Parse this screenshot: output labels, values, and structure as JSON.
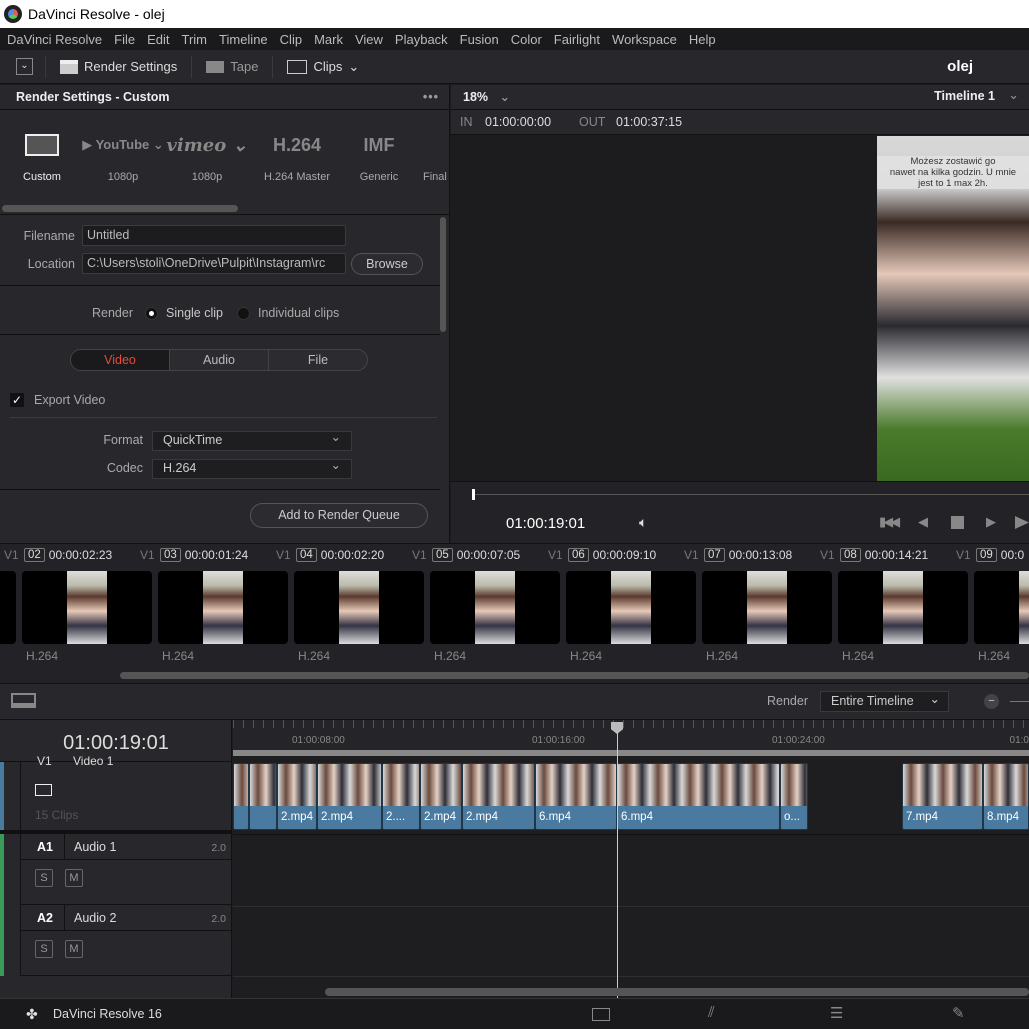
{
  "app": {
    "title": "DaVinci Resolve - olej",
    "project": "olej",
    "footer": "DaVinci Resolve 16"
  },
  "menu": [
    "DaVinci Resolve",
    "File",
    "Edit",
    "Trim",
    "Timeline",
    "Clip",
    "Mark",
    "View",
    "Playback",
    "Fusion",
    "Color",
    "Fairlight",
    "Workspace",
    "Help"
  ],
  "toolbar": {
    "render_settings": "Render Settings",
    "tape": "Tape",
    "clips": "Clips"
  },
  "render": {
    "title": "Render Settings - Custom",
    "more": "•••",
    "presets": [
      {
        "name": "",
        "label": "Custom",
        "icon": "film-icon"
      },
      {
        "name": "▶ YouTube ⌄",
        "label": "1080p"
      },
      {
        "name": "vimeo ⌄",
        "label": "1080p"
      },
      {
        "name": "H.264",
        "label": "H.264 Master"
      },
      {
        "name": "IMF",
        "label": "Generic"
      },
      {
        "name": "",
        "label": "Final"
      }
    ],
    "filename_label": "Filename",
    "filename": "Untitled",
    "location_label": "Location",
    "location": "C:\\Users\\stoli\\OneDrive\\Pulpit\\Instagram\\rc",
    "browse": "Browse",
    "render_label": "Render",
    "single_clip": "Single clip",
    "individual_clips": "Individual clips",
    "render_mode": "Single clip",
    "tabs": [
      "Video",
      "Audio",
      "File"
    ],
    "active_tab": "Video",
    "export_video": "Export Video",
    "export_video_checked": true,
    "format_label": "Format",
    "format": "QuickTime",
    "codec_label": "Codec",
    "codec": "H.264",
    "add_queue": "Add to Render Queue"
  },
  "viewer": {
    "zoom": "18%",
    "timeline": "Timeline 1",
    "in_label": "IN",
    "in": "01:00:00:00",
    "out_label": "OUT",
    "out": "01:00:37:15",
    "timecode": "01:00:19:01",
    "overlay_text": [
      "Możesz zostawić go",
      "nawet na kilka godzin. U mnie",
      "jest to 1 max 2h."
    ]
  },
  "clips": [
    {
      "track": "V1",
      "num": "02",
      "duration": "00:00:02:23",
      "codec": "H.264"
    },
    {
      "track": "V1",
      "num": "03",
      "duration": "00:00:01:24",
      "codec": "H.264"
    },
    {
      "track": "V1",
      "num": "04",
      "duration": "00:00:02:20",
      "codec": "H.264"
    },
    {
      "track": "V1",
      "num": "05",
      "duration": "00:00:07:05",
      "codec": "H.264"
    },
    {
      "track": "V1",
      "num": "06",
      "duration": "00:00:09:10",
      "codec": "H.264"
    },
    {
      "track": "V1",
      "num": "07",
      "duration": "00:00:13:08",
      "codec": "H.264"
    },
    {
      "track": "V1",
      "num": "08",
      "duration": "00:00:14:21",
      "codec": "H.264"
    },
    {
      "track": "V1",
      "num": "09",
      "duration": "00:0",
      "codec": "H.264"
    }
  ],
  "timeline": {
    "render_label": "Render",
    "render_range": "Entire Timeline",
    "timecode": "01:00:19:01",
    "ruler": [
      "01:00:08:00",
      "01:00:16:00",
      "01:00:24:00",
      "01:0"
    ],
    "video_track": {
      "id": "V1",
      "name": "Video 1",
      "count": "15 Clips"
    },
    "audio_tracks": [
      {
        "id": "A1",
        "name": "Audio 1",
        "channels": "2.0"
      },
      {
        "id": "A2",
        "name": "Audio 2",
        "channels": "2.0"
      }
    ],
    "solo": "S",
    "mute": "M",
    "track_clips": [
      "",
      "",
      "2.mp4",
      "2.mp4",
      "2....",
      "2.mp4",
      "2.mp4",
      "6.mp4",
      "6.mp4",
      "o...",
      "7.mp4",
      "8.mp4"
    ]
  }
}
